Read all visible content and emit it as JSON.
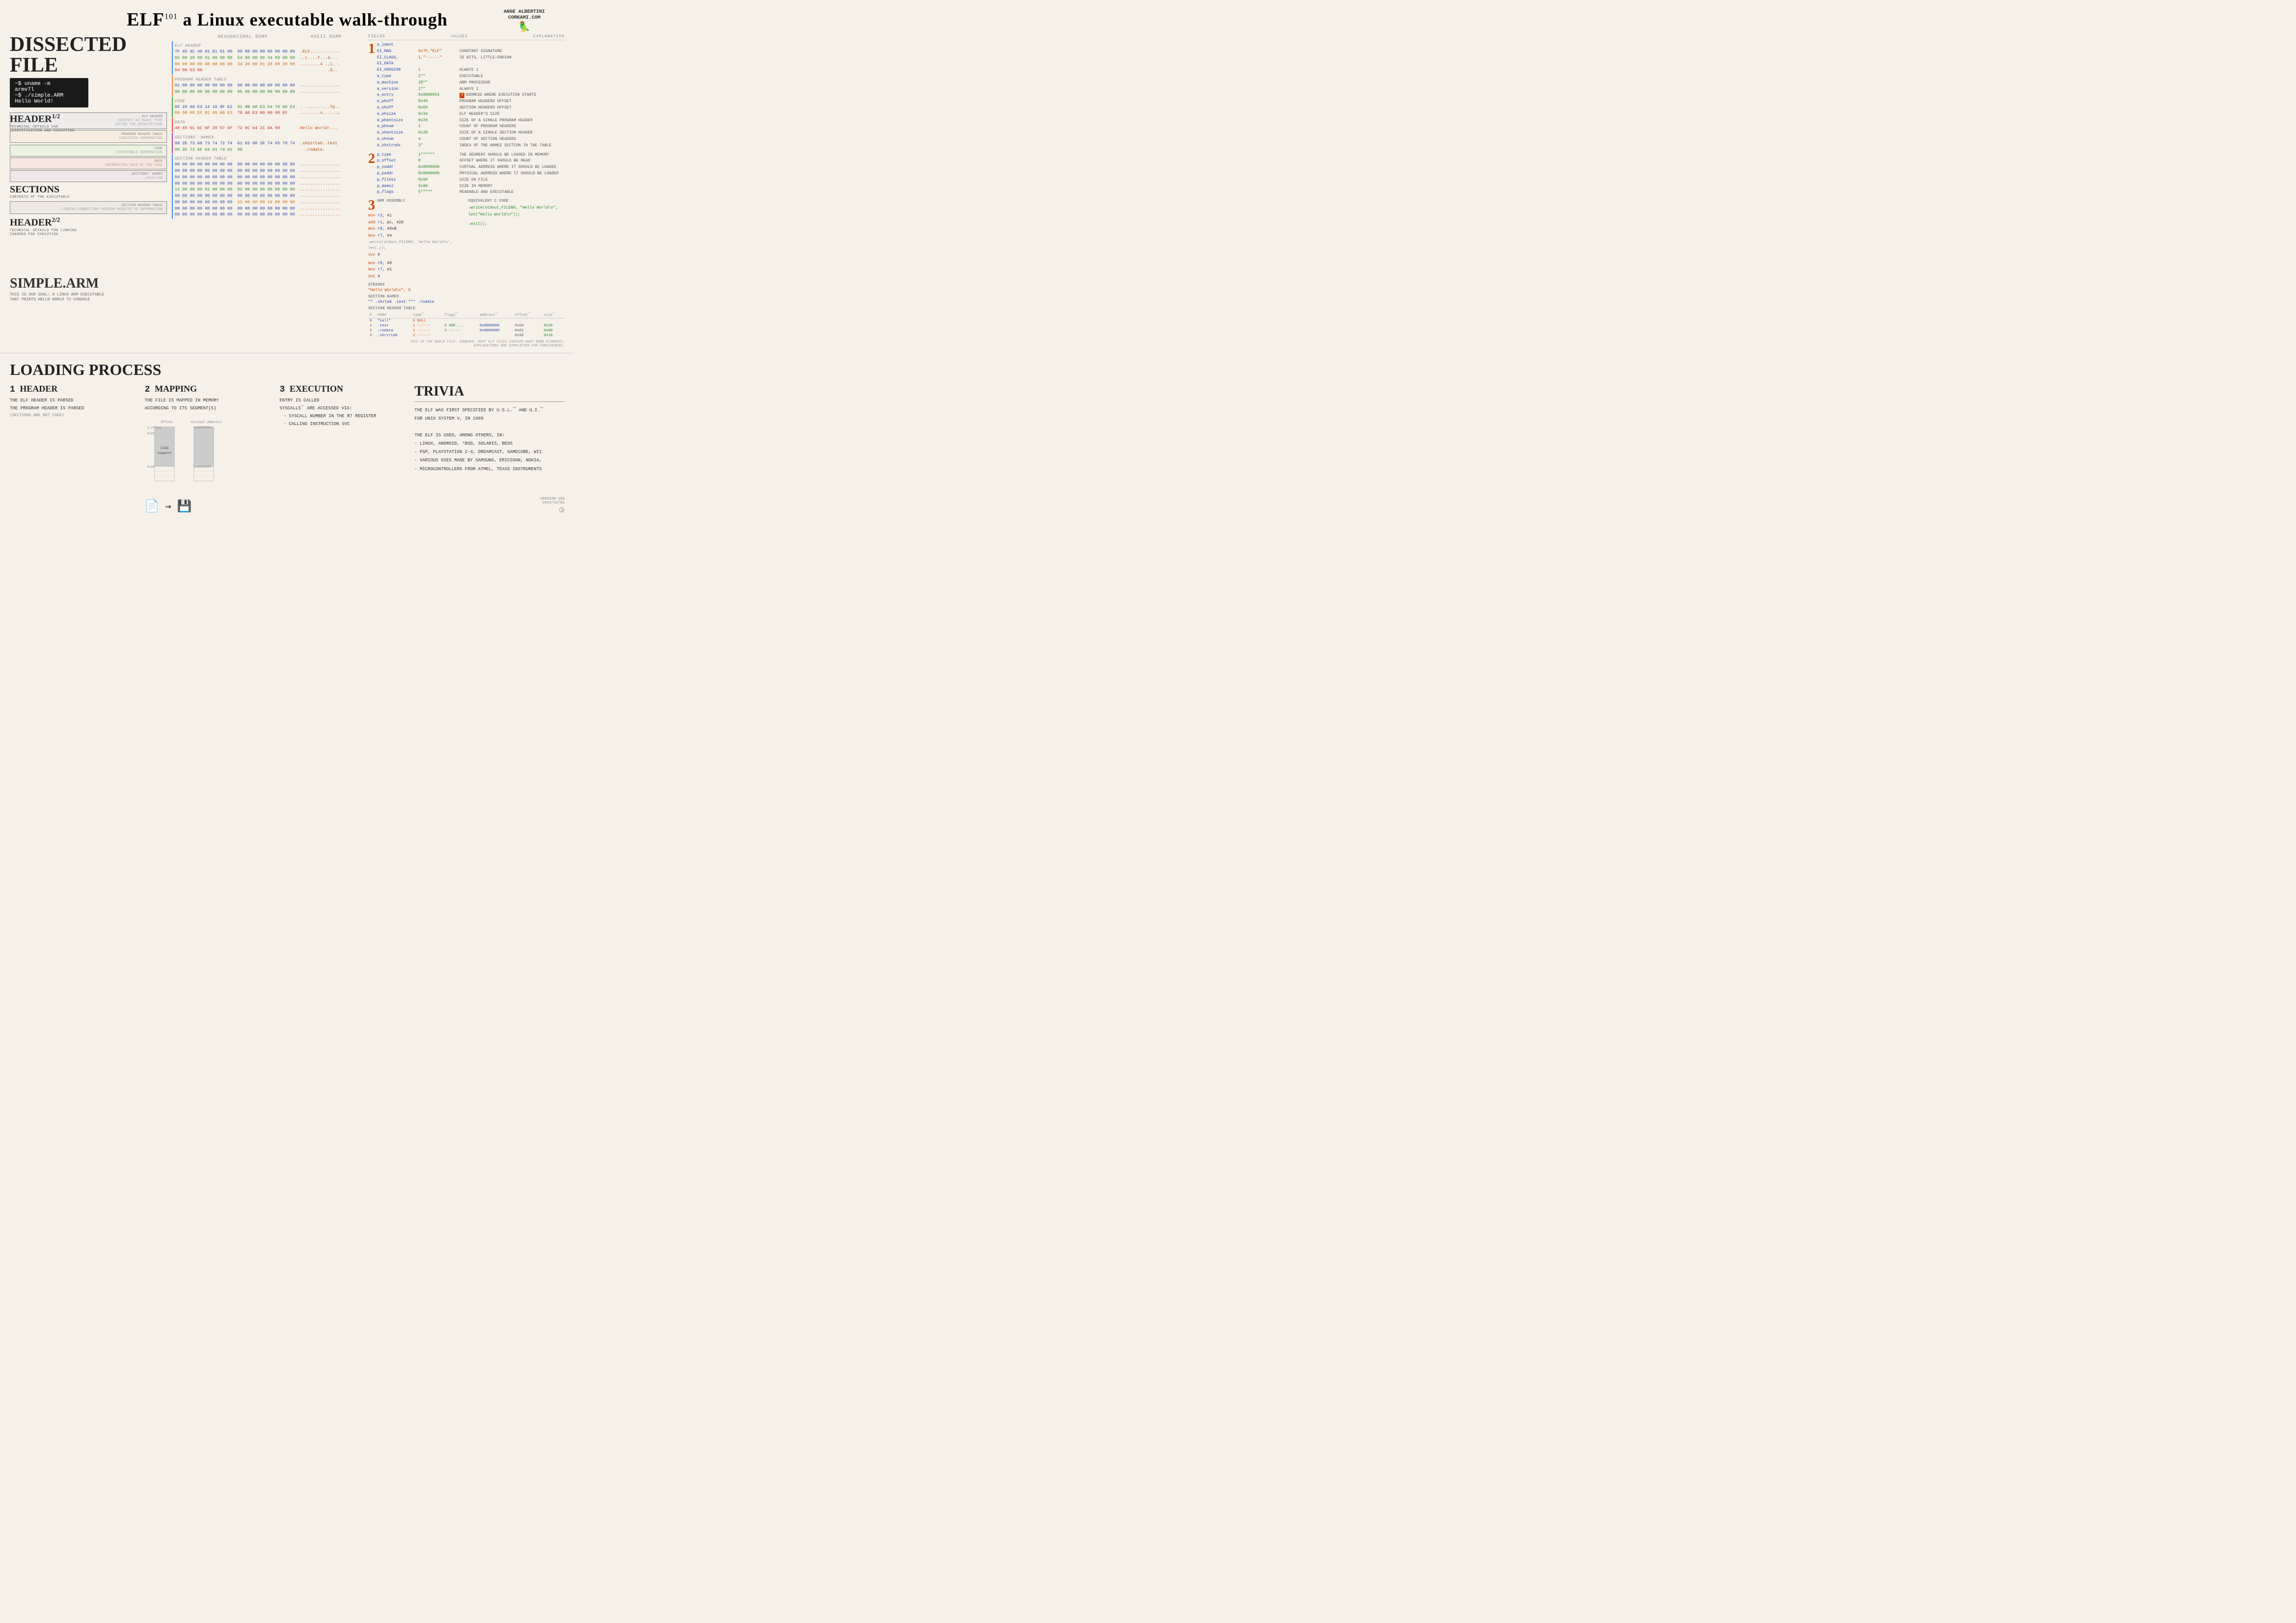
{
  "title": {
    "main": "ELF",
    "sup": "101",
    "subtitle": "a Linux executable walk-through",
    "author": "ANGE ALBERTINI\nCORKAMI.COM"
  },
  "dissected": {
    "title": "DISSECTED FILE",
    "terminal": {
      "lines": [
        "~$ uname -m",
        "armv7l",
        "~$ ./simple.ARM",
        "Hello World!"
      ]
    },
    "file_label": "SIMPLE.ARM",
    "file_subtitle": "THIS IS OUR GOAL: A LINUX ARM EXECUTABLE\nTHAT PRINTS HELLO WORLD TO CONSOLE",
    "header1": {
      "title": "HEADER",
      "sup": "1/2",
      "sub": "TECHNICAL DETAILS FOR\nIDENTIFICATION AND EXECUTION"
    },
    "sections": {
      "title": "SECTIONS",
      "sub": "CONTENTS OF THE EXECUTABLE"
    },
    "header2": {
      "title": "HEADER",
      "sup": "2/2",
      "sub": "TECHNICAL DETAILS FOR LINKING\nIGNORED FOR EXECUTION"
    }
  },
  "hex_sections": {
    "header_label": "HEXADECIMAL DUMP",
    "ascii_label": "ASCII DUMP",
    "elf_header": {
      "label": "ELF HEADER",
      "sublabel": "IDENTIFY AS MAGIC TYPE\nDEFINE THE ARCHITECTURE",
      "rows": [
        "7F 45 4C 46 01 01 01 00  00 00 00 00 00 00 00 00  .ELF............",
        "02 00 28 00 01 00 00 00  54 80 00 00 34 00 00 00  ..(....T...4...",
        "00 00 00 00 00 00 00 00  34 20 00 01 28 00 20 00  ........4 ..(. .",
        "04 00 53 00             "
      ]
    },
    "prog_header": {
      "label": "PROGRAM HEADER TABLE",
      "sublabel": "EXECUTION INFORMATION",
      "rows": [
        "01 00 00 00 00 00 00 00  00 00 00 00 00 00 00 00  ................",
        "90 00 00 00 90 00 00 00  05 00 00 00 00 00 00 00  ................"
      ]
    },
    "code": {
      "label": "CODE",
      "sublabel": "EXECUTABLE INFORMATION",
      "rows": [
        "05 20 A0 E3 14 10 8F E2  01 0B A0 E3 54 70 A0 E3  . ..........Tp..",
        "00 00 00 EF B1 00 A0 E3  75 A0 E3 00 00 00 EF  ..........u......"
      ]
    },
    "data": {
      "label": "DATA",
      "sublabel": "INFORMATION USED BY THE CODE",
      "rows": [
        "48 65 6C 6C 6F 20 57 6F  72 6C 64 21 0A 00       Hello World!..."
      ]
    },
    "section_names": {
      "label": "SECTIONS' NAMES",
      "sublabel": ".shstrtab",
      "rows": [
        "00 2E 73 68 73 74 72 74  61 62 00 2E 74 65 78 74  ..shstrtab..text",
        "00 2E 72 6F 64 61 74 61  61 62 00                 ..rodata.ab."
      ]
    },
    "section_header": {
      "label": "SECTION HEADER TABLE",
      "sublabel": "LINKING-CONNECTING PROGRAM OBJECTS TO INFORMATION",
      "rows": [
        "00 00 00 00 00 00 00 00  00 00 00 00 00 00 00 00  ................",
        "00 00 00 00 00 00 00 00  00 00 00 00 00 00 00 00  ................",
        "04 00 00 00 00 00 00 00  00 00 00 00 00 00 00 00  ................",
        "00 00 00 00 06 00 00 00  00 00 00 00 00 00 00 00  ................",
        "11 00 00 00 01 00 00 00  02 00 00 00 00 00 00 00  ................",
        "00 00 00 00 00 00 00 00  00 00 00 00 00 00 00 00  ................",
        "00 00 00 00 00 00 00 00  13 00 00 00 19 00 00 00  ................",
        "00 00 00 00 00 00 00 00  00 00 00 00 00 00 00 00  ................",
        "00 00 00 00 00 00 00 00  00 00 00 00 00 00 00 00  ................"
      ]
    }
  },
  "annotations": {
    "fields_col": "FIELDS",
    "values_col": "VALUES",
    "explanation_col": "EXPLANATION",
    "section1": {
      "number": "1",
      "label": "e_ident",
      "fields": [
        {
          "name": "EI_MAG",
          "value": "0x7F,\"ELF\"",
          "explain": "CONSTANT SIGNATURE"
        },
        {
          "name": "EI_CLASS, EI_DATA",
          "value": "1,\"-----\"",
          "explain": "32 BITS, LITTLE-ENDIAN"
        },
        {
          "name": "EI_VERSION",
          "value": "1\"\"\"\"\"\"\"1",
          "explain": "ALWAYS 1"
        },
        {
          "name": "e_type",
          "value": "2\"\"",
          "explain": "EXECUTABLE"
        },
        {
          "name": "e_machine",
          "value": "28\"\"",
          "explain": "ARM PROCESSOR"
        },
        {
          "name": "e_version",
          "value": "1\"\"\"\"\"",
          "explain": "ALWAYS 1"
        },
        {
          "name": "e_entry",
          "value": "0x8080054",
          "explain": "ADDRESS WHERE EXECUTION STARTS"
        },
        {
          "name": "e_phoff",
          "value": "0x40",
          "explain": "PROGRAM HEADERS OFFSET"
        },
        {
          "name": "e_shoff",
          "value": "0x00",
          "explain": "SECTION HEADERS OFFSET"
        },
        {
          "name": "e_ehsize",
          "value": "0x34",
          "explain": "ELF HEADER'S SIZE"
        },
        {
          "name": "e_phentsize",
          "value": "0x20",
          "explain": "SIZE OF A SINGLE PROGRAM HEADER"
        },
        {
          "name": "e_phnum",
          "value": "1",
          "explain": "COUNT OF PROGRAM HEADERS"
        },
        {
          "name": "e_shentsize",
          "value": "0x28",
          "explain": "SIZE OF A SINGLE SECTION HEADER"
        },
        {
          "name": "e_shnum",
          "value": "4",
          "explain": "COUNT OF SECTION HEADERS"
        },
        {
          "name": "e_shstrndx",
          "value": "3\"",
          "explain": "INDEX OF THE NAMES SECTION IN THE TABLE"
        }
      ]
    },
    "section2": {
      "number": "2",
      "label": "p_type",
      "fields": [
        {
          "name": "p_type",
          "value": "1\"\"\"\"\"",
          "explain": "THE SEGMENT SHOULD BE LOADED IN MEMORY"
        },
        {
          "name": "p_offset",
          "value": "0",
          "explain": "OFFSET WHERE IT SHOULD BE READ"
        },
        {
          "name": "p_vaddr",
          "value": "0x8000000",
          "explain": "VIRTUAL ADDRESS WHERE IT SHOULD BE LOADED"
        },
        {
          "name": "p_paddr",
          "value": "0x8000000",
          "explain": "PHYSICAL ADDRESS WHERE IT SHOULD BE LOADED"
        },
        {
          "name": "p_filesz",
          "value": "0x90",
          "explain": "SIZE ON FILE"
        },
        {
          "name": "p_memsz",
          "value": "0x90",
          "explain": "SIZE IN MEMORY"
        },
        {
          "name": "p_flags",
          "value": "5\"\"\"\"\"",
          "explain": "READABLE AND EXECUTABLE"
        }
      ]
    },
    "section3_asm": {
      "number": "3",
      "label": "ARM ASSEMBLY",
      "code": [
        "mov r2, #1",
        "add r1, pc, #20",
        "mov r0, #0xB",
        "mov r7, #1",
        "→write(stdout_FILENO, 'Hello World\\n', len('Hello World\\n'));",
        "",
        "mov r0, #0\"\"\"\"\"",
        "mov r7, #1\"\"\"\"\"",
        "svc 0\"\"\"\"\"\"\"\"\"\"\"\"\"\"\"\"→exit();"
      ],
      "equiv_label": "EQUIVALENT C CODE"
    },
    "strings": {
      "label": "STRINGS",
      "values": [
        "\"Hello World\\n\", 0"
      ]
    },
    "section_names_label": "SECTION NAMES",
    "section_names_values": [
      "\"\", \".shrtab\", \".text\", \"\"\"\", \".rodata\""
    ],
    "sht": {
      "label": "SECTION HEADER TABLE",
      "cols": [
        "#",
        "NAME",
        "TYPE",
        "FLAGS",
        "ADDRESS",
        "OFFSET",
        "SIZE"
      ],
      "rows": [
        {
          "idx": "0",
          "name": "\"null\"",
          "type": "0 NULL",
          "flags": "",
          "address": "",
          "offset": "",
          "size": ""
        },
        {
          "idx": "1",
          "name": ".text",
          "type": "1 ------",
          "flags": "6 SHF_...",
          "address": "0x8000060",
          "offset": "0x60",
          "size": "0x20"
        },
        {
          "idx": "2",
          "name": ".rodata",
          "type": "1 ------",
          "flags": "2 ------",
          "address": "0x8000080",
          "offset": "0x81",
          "size": "0x0D"
        },
        {
          "idx": "3",
          "name": ".shrtrtab",
          "type": "3 ------",
          "flags": "",
          "address": "",
          "offset": "0x90",
          "size": "0x19"
        }
      ]
    },
    "note": "THIS IS THE WHOLE FILE. HOWEVER, MOST ELF FILES CONTAIN MANY MORE ELEMENTS.\nEXPLANATIONS ARE SIMPLIFIED FOR CONCISENESS."
  },
  "loading": {
    "title": "LOADING PROCESS",
    "step1": {
      "number": "1",
      "title": "HEADER",
      "items": [
        "THE ELF HEADER IS PARSED",
        "THE PROGRAM HEADER IS PARSED",
        "(SECTIONS ARE NOT USED)"
      ]
    },
    "step2": {
      "number": "2",
      "title": "MAPPING",
      "items": [
        "THE FILE IS MAPPED IN MEMORY",
        "ACCORDING TO ITS SEGMENT(S)"
      ]
    },
    "step3": {
      "number": "3",
      "title": "EXECUTION",
      "items": [
        "ENTRY IS CALLED",
        "SYSCALLS are ACCESSED VIA:",
        "- SYSCALL NUMBER IN THE R7 REGISTER",
        "- CALLING INSTRUCTION SVC"
      ]
    },
    "memory_diagram": {
      "labels": [
        "Offset",
        "Virtual Address"
      ],
      "segment_label": "LOAD Segment",
      "addr1": "p_offset",
      "addr2": "0x00",
      "addr3": "0x8000000+",
      "addr4": "0x90",
      "addr5": "0x8000090+"
    }
  },
  "trivia": {
    "title": "TRIVIA",
    "items": [
      "THE ELF WAS FIRST SPECIFIED BY U.S.L. AND U.I.",
      "FOR UNIX SYSTEM V, IN 1989",
      "",
      "THE ELF IS USED, AMONG OTHERS, IN:",
      "- LINUX, ANDROID, *BSD, SOLARIS, BEOS",
      "- PSP, PLAYSTATION 2-4, DREAMCAST, GAMECUBE, WII",
      "- VARIOUS OSES MADE BY SAMSUNG, ERICSSON, NOKIA,",
      "- MICROCONTROLLERS FROM ATMEL, TEXAS INSTRUMENTS"
    ]
  },
  "version": {
    "text": "VERSION 10A",
    "date": "2013/12/06"
  }
}
